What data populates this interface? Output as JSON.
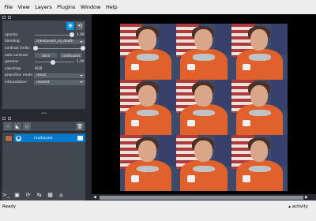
{
  "menu": [
    "File",
    "View",
    "Layers",
    "Plugins",
    "Window",
    "Help"
  ],
  "layer_controls": {
    "opacity": {
      "label": "opacity:",
      "value": "1.00",
      "fraction": 1.0
    },
    "blending": {
      "label": "blending:",
      "value": "translucent_no_depth"
    },
    "contrast_limits": {
      "label": "contrast limits:",
      "low": 0.0,
      "high": 1.0
    },
    "auto_contrast": {
      "label": "auto-contrast:",
      "once": "once",
      "continuous": "continuous"
    },
    "gamma": {
      "label": "gamma:",
      "value": "1.00",
      "fraction": 0.5
    },
    "colormap": {
      "label": "colormap:",
      "value": "RGB"
    },
    "projection_mode": {
      "label": "projection mode:",
      "value": "mean"
    },
    "interpolation": {
      "label": "interpolation:",
      "value": "nearest"
    }
  },
  "layers": [
    {
      "name": "multiscale",
      "visible": true,
      "selected": true
    }
  ],
  "status": {
    "ready": "Ready",
    "activity": "activity"
  },
  "colors": {
    "accent": "#0095e6",
    "selection": "#007acc",
    "panel": "#414851",
    "background": "#262930"
  },
  "icons": {
    "pan_zoom": "arrows-icon",
    "transform": "transform-icon",
    "new_points": "points-icon",
    "new_shapes": "shapes-icon",
    "new_labels": "labels-icon",
    "delete": "trash-icon",
    "console": "console-icon",
    "ndisplay": "ndisplay-icon",
    "roll": "roll-icon",
    "transpose": "transpose-icon",
    "grid": "grid-icon",
    "home": "home-icon"
  }
}
